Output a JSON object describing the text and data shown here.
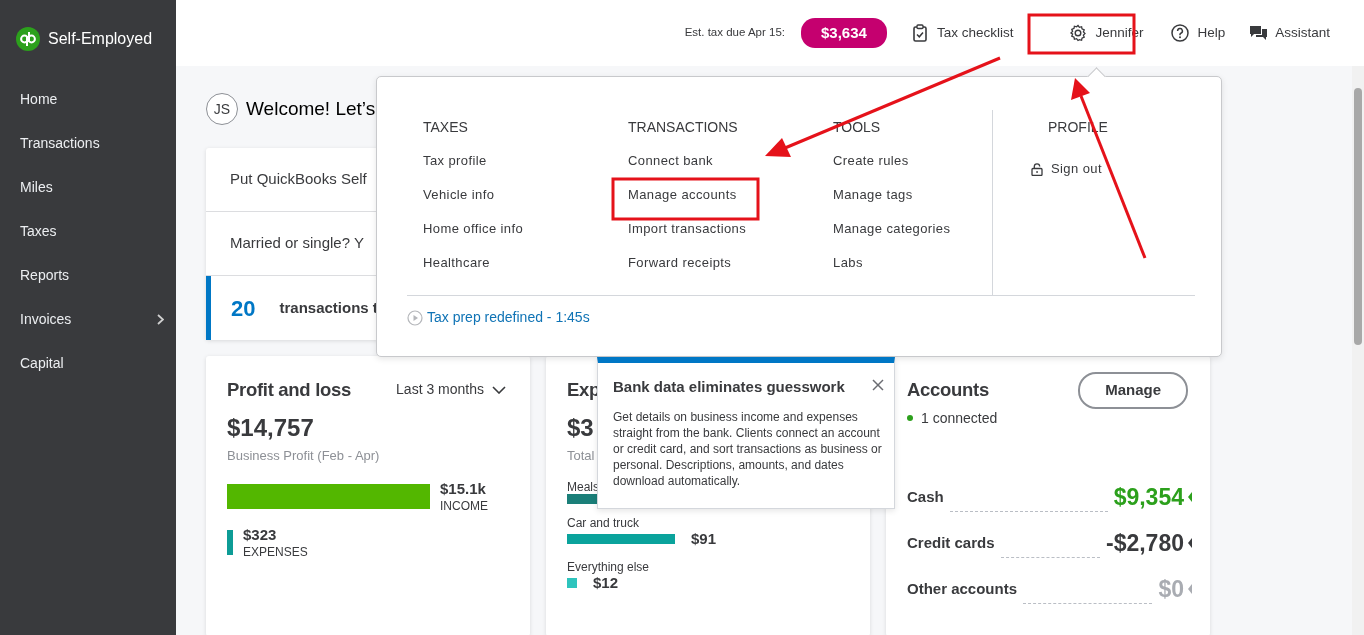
{
  "app": {
    "name": "Self-Employed"
  },
  "sidebar": {
    "items": [
      {
        "label": "Home",
        "has_submenu": false
      },
      {
        "label": "Transactions",
        "has_submenu": false
      },
      {
        "label": "Miles",
        "has_submenu": false
      },
      {
        "label": "Taxes",
        "has_submenu": false
      },
      {
        "label": "Reports",
        "has_submenu": false
      },
      {
        "label": "Invoices",
        "has_submenu": true
      },
      {
        "label": "Capital",
        "has_submenu": false
      }
    ]
  },
  "topbar": {
    "tax_label": "Est. tax due Apr 15:",
    "tax_amount": "$3,634",
    "links": [
      {
        "label": "Tax checklist",
        "kind": "checklist"
      },
      {
        "label": "Jennifer",
        "kind": "settings"
      },
      {
        "label": "Help",
        "kind": "help"
      },
      {
        "label": "Assistant",
        "kind": "chat"
      }
    ]
  },
  "welcome": {
    "initials": "JS",
    "text": "Welcome! Let’s"
  },
  "tasks": [
    {
      "kind": "text",
      "text": "Put QuickBooks Self",
      "selected": false
    },
    {
      "kind": "text",
      "text": "Married or single? Y",
      "selected": false
    },
    {
      "kind": "count",
      "count": "20",
      "text": "transactions t",
      "selected": true
    }
  ],
  "profit_loss": {
    "title": "Profit and loss",
    "period": "Last 3 months",
    "amount": "$14,757",
    "caption": "Business Profit (Feb - Apr)",
    "bars": [
      {
        "amount": "$15.1k",
        "label": "INCOME"
      },
      {
        "amount": "$323",
        "label": "EXPENSES"
      }
    ]
  },
  "expenses": {
    "title": "Exp",
    "amount": "$3",
    "caption": "Total",
    "categories": [
      {
        "name": "Meals",
        "color": "#1b7f79"
      },
      {
        "name": "Car and truck",
        "amount": "$91",
        "color": "#0aa39c"
      },
      {
        "name": "Everything else",
        "amount": "$12",
        "color": "#2ec4bd"
      }
    ]
  },
  "accounts": {
    "title": "Accounts",
    "button": "Manage",
    "status": "1 connected",
    "rows": [
      {
        "label": "Cash",
        "amount": "$9,354",
        "kind": "positive"
      },
      {
        "label": "Credit cards",
        "amount": "-$2,780",
        "kind": "negative"
      },
      {
        "label": "Other accounts",
        "amount": "$0",
        "kind": "zero"
      }
    ]
  },
  "menu": {
    "columns": [
      {
        "heading": "TAXES",
        "items": [
          "Tax profile",
          "Vehicle info",
          "Home office info",
          "Healthcare"
        ]
      },
      {
        "heading": "TRANSACTIONS",
        "items": [
          "Connect bank",
          "Manage accounts",
          "Import transactions",
          "Forward receipts"
        ]
      },
      {
        "heading": "TOOLS",
        "items": [
          "Create rules",
          "Manage tags",
          "Manage categories",
          "Labs"
        ]
      }
    ],
    "profile": {
      "heading": "PROFILE",
      "items": [
        "Sign out"
      ]
    },
    "video_link": "Tax prep redefined - 1:45s"
  },
  "tip": {
    "title": "Bank data eliminates guesswork",
    "body": "Get details on business income and expenses straight from the bank. Clients connect an account or credit card, and sort transactions as business or personal. Descriptions, amounts, and dates download automatically."
  }
}
